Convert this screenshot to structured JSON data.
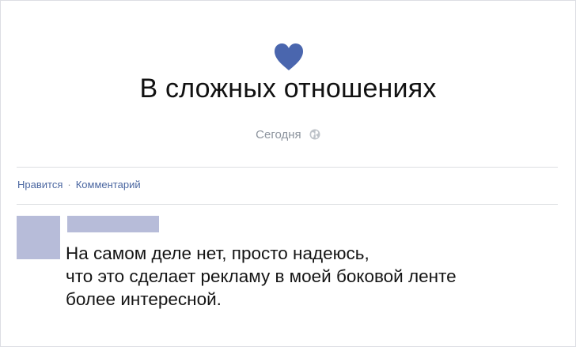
{
  "status": {
    "title": "В сложных отношениях",
    "date": "Сегодня",
    "icon": "heart-icon",
    "icon_color": "#4a66ae"
  },
  "actions": {
    "like": "Нравится",
    "separator": "·",
    "comment": "Комментарий",
    "link_color": "#4b67a1"
  },
  "comment": {
    "lines": [
      "На самом деле нет, просто надеюсь,",
      "что это сделает рекламу в моей боковой ленте",
      "более интересной."
    ],
    "placeholder_color": "#b7bcd9"
  }
}
